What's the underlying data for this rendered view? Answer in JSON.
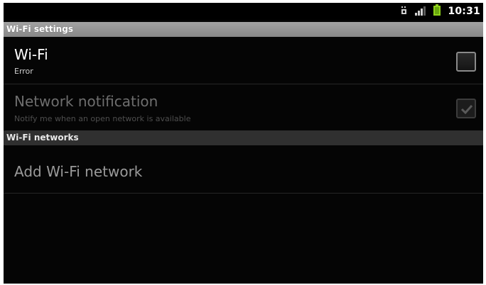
{
  "status_bar": {
    "time": "10:31",
    "icons": [
      "notification-icon",
      "signal-icon",
      "battery-icon"
    ],
    "battery_color": "#8fd11c"
  },
  "sections": {
    "settings_header": "Wi-Fi settings",
    "networks_header": "Wi-Fi networks"
  },
  "wifi": {
    "title": "Wi-Fi",
    "summary": "Error",
    "checked": false
  },
  "network_notification": {
    "title": "Network notification",
    "summary": "Notify me when an open network is available",
    "checked": true,
    "enabled": false
  },
  "add_network": {
    "title": "Add Wi-Fi network"
  }
}
